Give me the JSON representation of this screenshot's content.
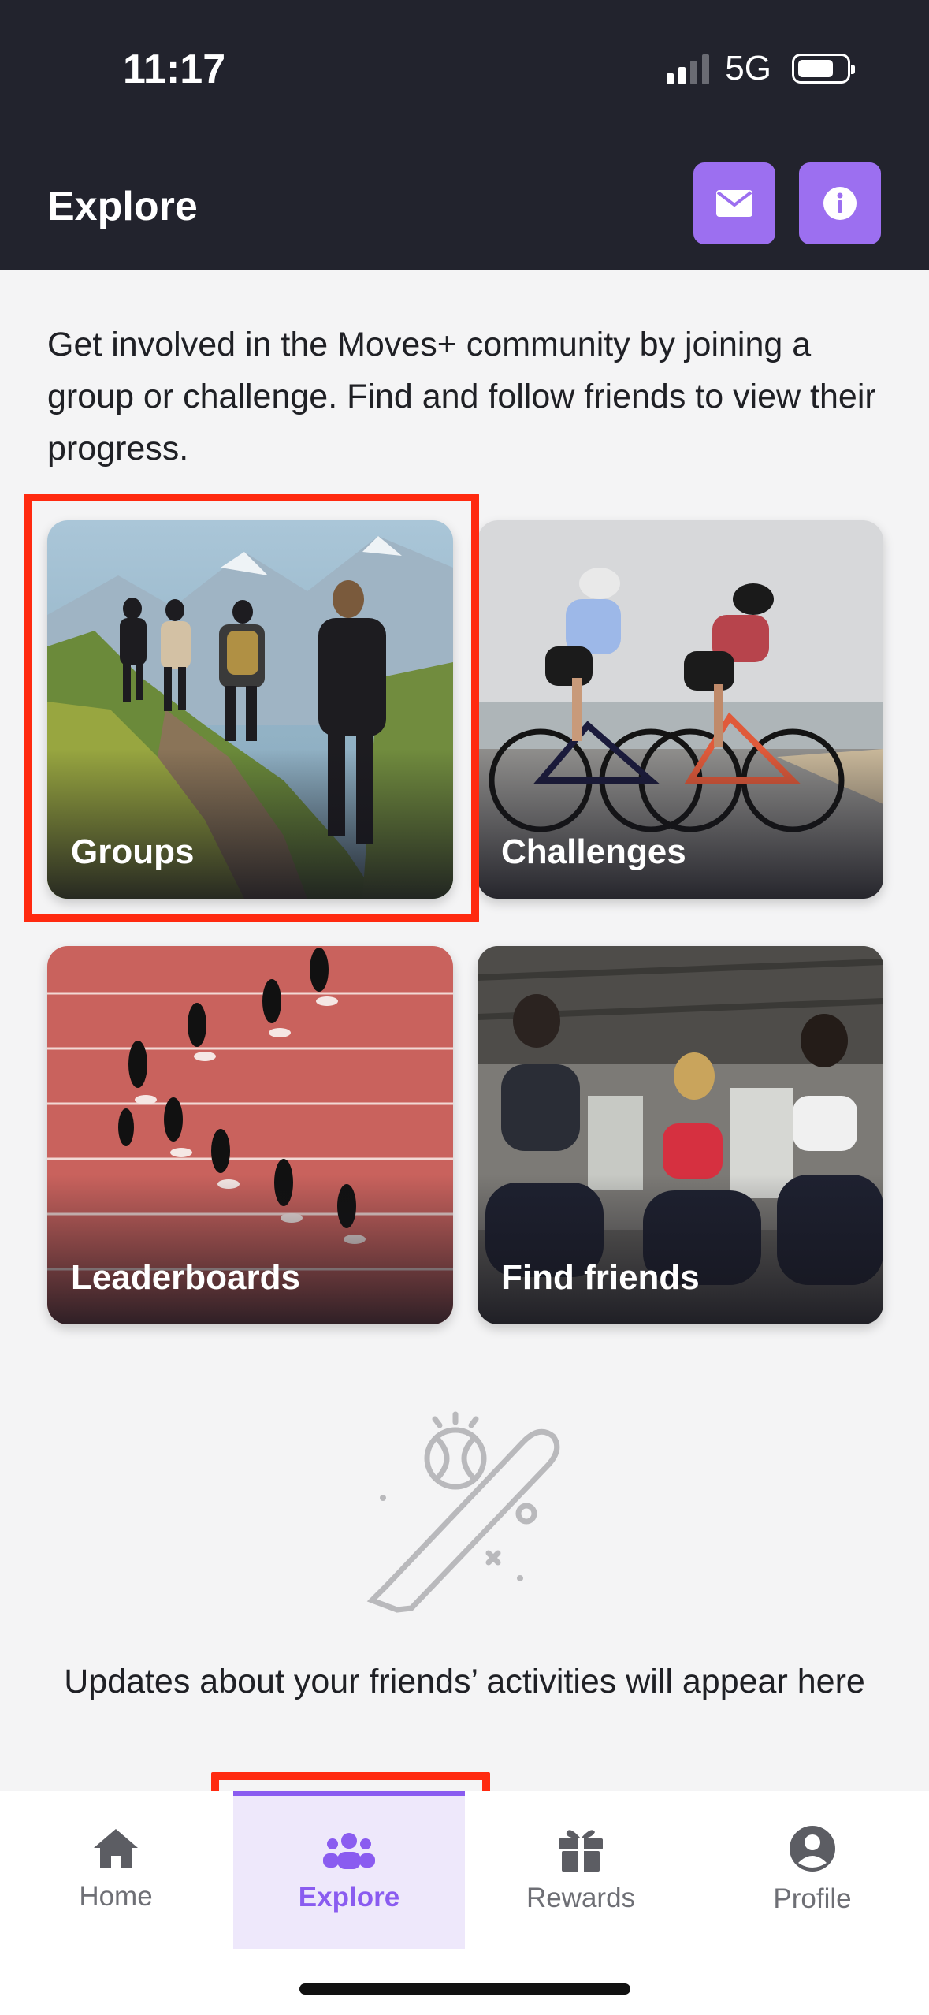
{
  "status": {
    "time": "11:17",
    "network": "5G"
  },
  "header": {
    "title": "Explore",
    "mail_icon": "envelope-icon",
    "info_icon": "info-icon",
    "accent_color": "#9c6ff0"
  },
  "intro": "Get involved in the Moves+ community by joining a group or challenge. Find and follow friends to view their progress.",
  "tiles": [
    {
      "label": "Groups"
    },
    {
      "label": "Challenges"
    },
    {
      "label": "Leaderboards"
    },
    {
      "label": "Find friends"
    }
  ],
  "empty_state": {
    "icon": "baseball-bat-icon",
    "text": "Updates about your friends’ activities will appear here"
  },
  "tabbar": {
    "active": "Explore",
    "items": [
      {
        "label": "Home",
        "icon": "home-icon"
      },
      {
        "label": "Explore",
        "icon": "people-icon"
      },
      {
        "label": "Rewards",
        "icon": "gift-icon"
      },
      {
        "label": "Profile",
        "icon": "user-circle-icon"
      }
    ]
  },
  "highlight_color": "#ff2a10"
}
